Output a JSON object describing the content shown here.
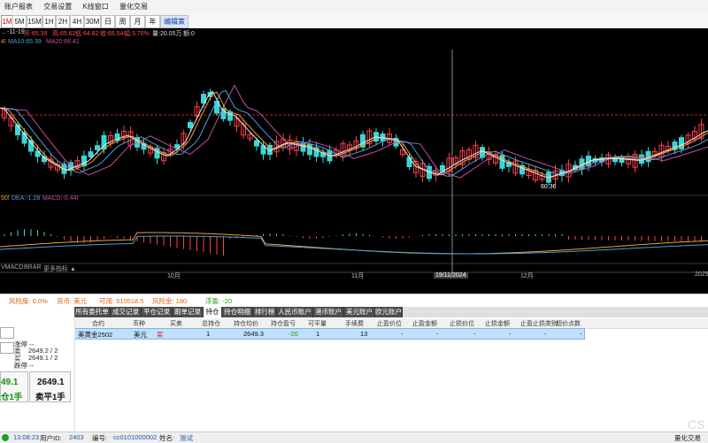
{
  "menu": [
    "账户报表",
    "交易设置",
    "K线窗口",
    "量化交易"
  ],
  "timeframes": [
    {
      "label": "1M",
      "active": true
    },
    {
      "label": "5M"
    },
    {
      "label": "15M"
    },
    {
      "label": "1H"
    },
    {
      "label": "2H"
    },
    {
      "label": "4H"
    },
    {
      "label": "30M"
    },
    {
      "label": "日"
    },
    {
      "label": "周"
    },
    {
      "label": "月"
    },
    {
      "label": "年"
    }
  ],
  "edit_strategy_label": "编辑策略",
  "chart": {
    "info_line": {
      "date": "…-11-19",
      "open": "开:65.39",
      "high": "高:65.62",
      "low": "低:64.82",
      "close": "收:65.54",
      "change": "幅:3.70%",
      "volume": "量:20.05万",
      "amount": "额:0"
    },
    "ma_line": {
      "prefix": "4!",
      "ma10": "MA10:65.39",
      "ma20": "MA20:66.41"
    },
    "macd_line": {
      "prefix": "50!",
      "dea": "DEA:-1.28",
      "macd": "MACD:-0.44!"
    },
    "indicator_tabs": [
      "VMACD",
      "BRAR",
      "更多指标 ▲"
    ],
    "low_marker": "60.36",
    "x_labels": [
      "10月",
      "11月",
      "19/11/2024",
      "12月",
      "2025"
    ]
  },
  "colors": {
    "up": "#ff3b4a",
    "down": "#39d6d6",
    "ma_white": "#e8e8e8",
    "ma_orange": "#f0a030",
    "ma_pink": "#c2509a",
    "ma_blue": "#4a9fe0",
    "price_line": "#cc2020"
  },
  "account": {
    "risk_rate": "风险度: 0.0%",
    "currency": "货币: 美元",
    "available": "可用: 510518.5",
    "margin": "风险金: 180",
    "float_pl": "浮盈: -20"
  },
  "bottom_tabs": [
    "所有委托单",
    "成交记录",
    "平仓记录",
    "跟单记录",
    "持仓",
    "持仓明细",
    "排行榜",
    "人民币账户",
    "港币账户",
    "美元账户",
    "欧元账户"
  ],
  "active_bottom_tab": "持仓",
  "grid_headers": [
    "合约",
    "币种",
    "买卖",
    "总持仓",
    "持仓均价",
    "持仓盈亏",
    "可平量",
    "手续费",
    "止盈价位",
    "止盈金额",
    "止损价位",
    "止损金额",
    "止盈止损类别",
    "超价点数"
  ],
  "position": {
    "contract": "美黄金2502",
    "currency": "美元",
    "side": "买",
    "total": "1",
    "avg_price": "2649.3",
    "pl": "-20",
    "closable": "1",
    "fee": "13",
    "tp_price": "-",
    "tp_amount": "-",
    "sl_price": "-",
    "sl_amount": "-",
    "tp_sl_type": "-",
    "over_points": "-"
  },
  "order_panel": {
    "limit_label": "涨停 --",
    "sell_label": "卖",
    "sell_value": "2649.2 / 2",
    "buy_label": "买",
    "buy_value": "2649.1 / 2",
    "drop_label": "跌停 --",
    "buy_price": "49.1",
    "buy_action": "仓1手",
    "sell_price": "2649.1",
    "sell_action": "卖平1手"
  },
  "status": {
    "time": "13:08:23",
    "user_label": "用户ID:",
    "user_id": "2403",
    "code_label": "编号:",
    "code": "cc0101000002",
    "name_label": "姓名:",
    "name": "测试",
    "right_label": "量化交易"
  },
  "watermark": "CS"
}
